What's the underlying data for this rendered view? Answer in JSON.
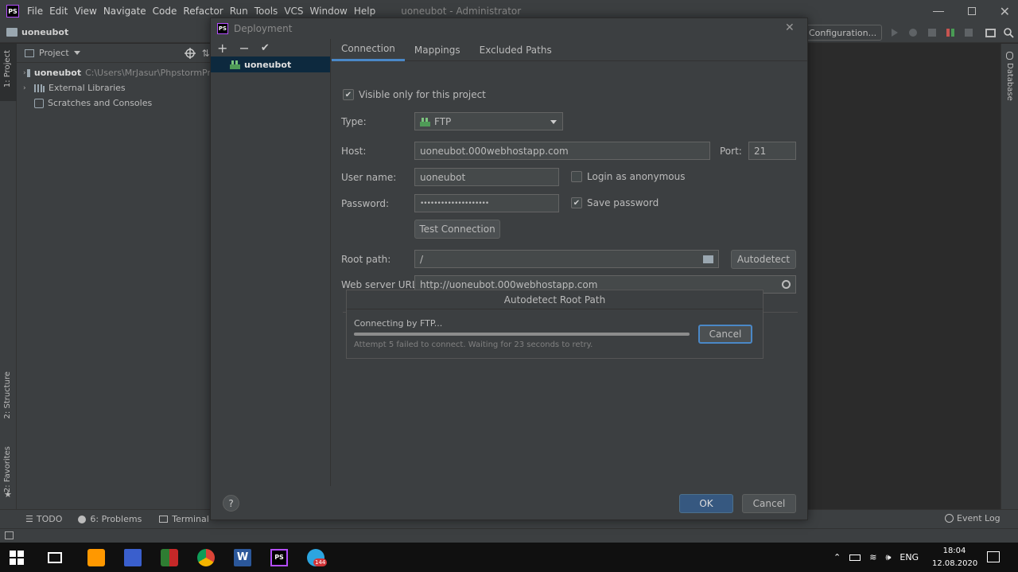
{
  "window": {
    "menu": [
      "File",
      "Edit",
      "View",
      "Navigate",
      "Code",
      "Refactor",
      "Run",
      "Tools",
      "VCS",
      "Window",
      "Help"
    ],
    "title": "uoneubot - Administrator",
    "breadcrumb": "uoneubot",
    "run_config_label": "Configuration..."
  },
  "left_strip": {
    "project": "1: Project",
    "structure": "2: Structure",
    "favorites": "2: Favorites"
  },
  "right_strip": {
    "database": "Database"
  },
  "project_panel": {
    "title": "Project",
    "tree": [
      {
        "label": "uoneubot",
        "path": "C:\\Users\\MrJasur\\PhpstormPr"
      },
      {
        "label": "External Libraries"
      },
      {
        "label": "Scratches and Consoles"
      }
    ]
  },
  "bottom_tabs": [
    "TODO",
    "6: Problems",
    "Terminal"
  ],
  "event_log": "Event Log",
  "dialog": {
    "title": "Deployment",
    "server_name": "uoneubot",
    "tabs": [
      "Connection",
      "Mappings",
      "Excluded Paths"
    ],
    "visible_only_label": "Visible only for this project",
    "type_label": "Type:",
    "type_value": "FTP",
    "host_label": "Host:",
    "host_value": "uoneubot.000webhostapp.com",
    "port_label": "Port:",
    "port_value": "21",
    "username_label": "User name:",
    "username_value": "uoneubot",
    "anonymous_label": "Login as anonymous",
    "password_label": "Password:",
    "password_value": "••••••••••••••••••••",
    "save_password_label": "Save password",
    "test_connection": "Test Connection",
    "root_path_label": "Root path:",
    "root_path_value": "/",
    "autodetect": "Autodetect",
    "web_url_label": "Web server URL:",
    "web_url_value": "http://uoneubot.000webhostapp.com",
    "ok": "OK",
    "cancel": "Cancel",
    "help": "?"
  },
  "progress": {
    "title": "Autodetect Root Path",
    "status": "Connecting by FTP...",
    "detail": "Attempt 5 failed to connect. Waiting for 23 seconds to retry.",
    "cancel": "Cancel",
    "fraction": 1.0
  },
  "taskbar": {
    "telegram_badge": "144",
    "lang": "ENG",
    "time": "18:04",
    "date": "12.08.2020"
  },
  "colors": {
    "accent": "#4a88c7",
    "primary_button": "#365880",
    "panel": "#3c3f41",
    "editor": "#2b2b2b"
  }
}
